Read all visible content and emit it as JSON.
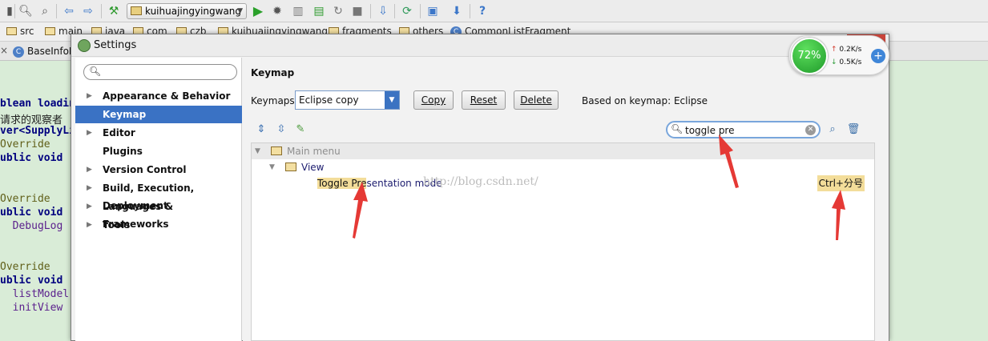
{
  "toolbar": {
    "run_config": "kuihuajingyingwang",
    "icons": [
      "search-icon",
      "replace-icon",
      "back-arrow-icon",
      "forward-arrow-icon",
      "build-hammer-icon",
      "run-icon",
      "debug-icon",
      "coverage-icon",
      "profile-icon",
      "rerun-icon",
      "stop-icon",
      "sdk-manager-icon",
      "sync-icon",
      "project-structure-icon",
      "android-device-monitor-icon",
      "help-icon"
    ]
  },
  "navbar": {
    "crumbs": [
      "src",
      "main",
      "java",
      "com",
      "czb",
      "kuihuajingyingwang",
      "fragments",
      "others",
      "CommonListFragment"
    ]
  },
  "editor_tab": {
    "label": "BaseInfoF"
  },
  "editor": {
    "lines": [
      "blean loadin",
      "请求的观察者",
      "ver<SupplyLi",
      "Override",
      "ublic void",
      "Override",
      "ublic void",
      "  DebugLog",
      "Override",
      "ublic void",
      "  listModel",
      "  initView"
    ]
  },
  "dialog": {
    "title": "Settings",
    "close": "✕",
    "search_placeholder": "",
    "nav": [
      {
        "label": "Appearance & Behavior",
        "expandable": true
      },
      {
        "label": "Keymap",
        "expandable": false,
        "selected": true
      },
      {
        "label": "Editor",
        "expandable": true
      },
      {
        "label": "Plugins",
        "expandable": false
      },
      {
        "label": "Version Control",
        "expandable": true
      },
      {
        "label": "Build, Execution, Deployment",
        "expandable": true
      },
      {
        "label": "Languages & Frameworks",
        "expandable": true
      },
      {
        "label": "Tools",
        "expandable": true
      }
    ],
    "keymap": {
      "title": "Keymap",
      "keymaps_label": "Keymaps:",
      "selected_keymap": "Eclipse copy",
      "copy": "Copy",
      "reset": "Reset",
      "delete": "Delete",
      "based_on": "Based on keymap: Eclipse",
      "filter_value": "toggle pre",
      "tree": {
        "root": "Main menu",
        "group": "View",
        "action_match": "Toggle Pre",
        "action_rest": "sentation mode",
        "shortcut": "Ctrl+分号"
      },
      "watermark": "http://blog.csdn.net/"
    }
  },
  "net_widget": {
    "percent": "72%",
    "up": "0.2K/s",
    "down": "0.5K/s",
    "plus": "+"
  },
  "colors": {
    "selection": "#3a72c4",
    "highlight": "#f3dd9a",
    "annotation_arrow": "#e53935"
  }
}
